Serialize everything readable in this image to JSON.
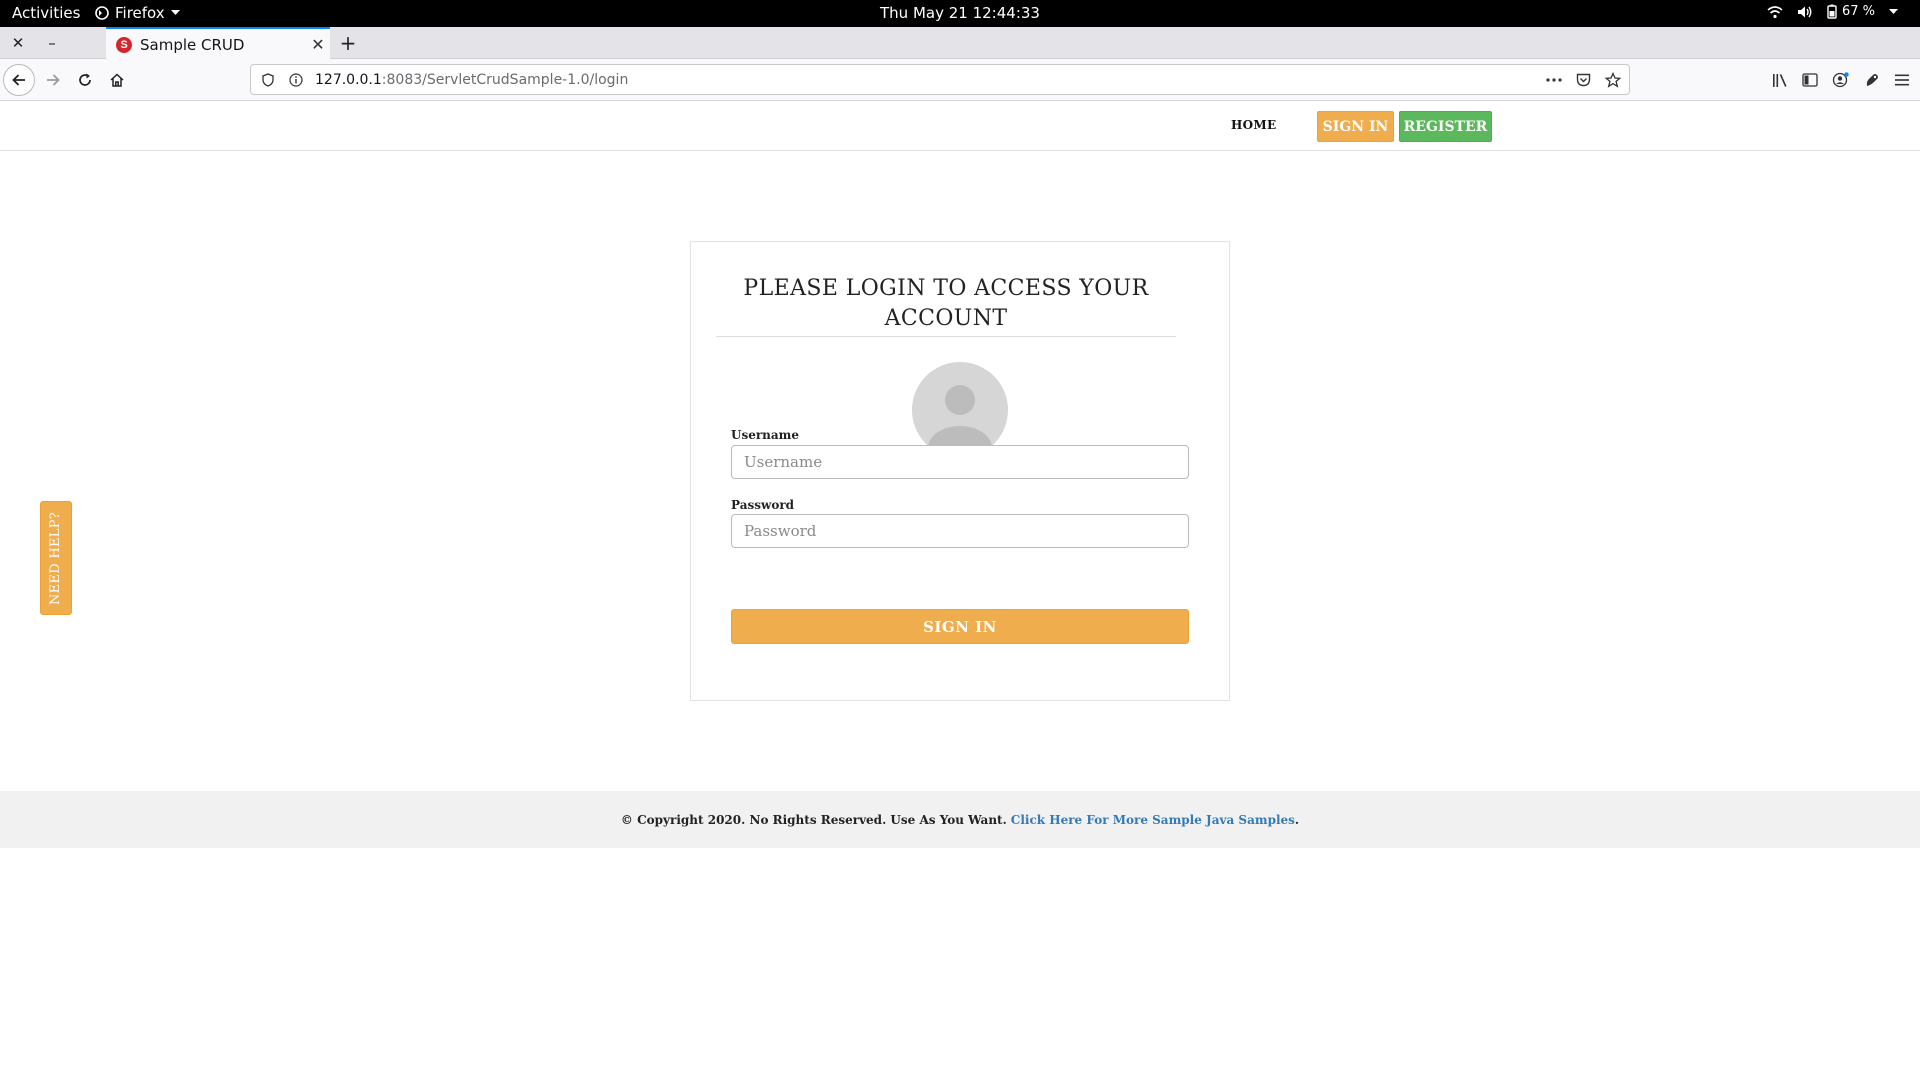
{
  "system_bar": {
    "activities": "Activities",
    "app_menu": "Firefox",
    "clock": "Thu May 21  12:44:33",
    "battery": "67 %"
  },
  "browser": {
    "tab_title": "Sample CRUD",
    "favicon_letter": "S",
    "url_host": "127.0.0.1",
    "url_path": ":8083/ServletCrudSample-1.0/login",
    "accent": "#0a84ff"
  },
  "site_nav": {
    "home": "HOME",
    "sign_in": "SIGN IN",
    "register": "REGISTER"
  },
  "login_card": {
    "heading": "PLEASE LOGIN TO ACCESS YOUR ACCOUNT",
    "username_label": "Username",
    "username_placeholder": "Username",
    "username_value": "",
    "password_label": "Password",
    "password_placeholder": "Password",
    "password_value": "",
    "submit": "SIGN IN"
  },
  "help_tab": "NEED HELP?",
  "footer": {
    "text": "© Copyright 2020. No Rights Reserved. Use As You Want.",
    "link": "Click Here For More Sample Java Samples",
    "period": "."
  },
  "colors": {
    "warning": "#f0ad4e",
    "success": "#5cb85c",
    "link": "#337ab7"
  }
}
